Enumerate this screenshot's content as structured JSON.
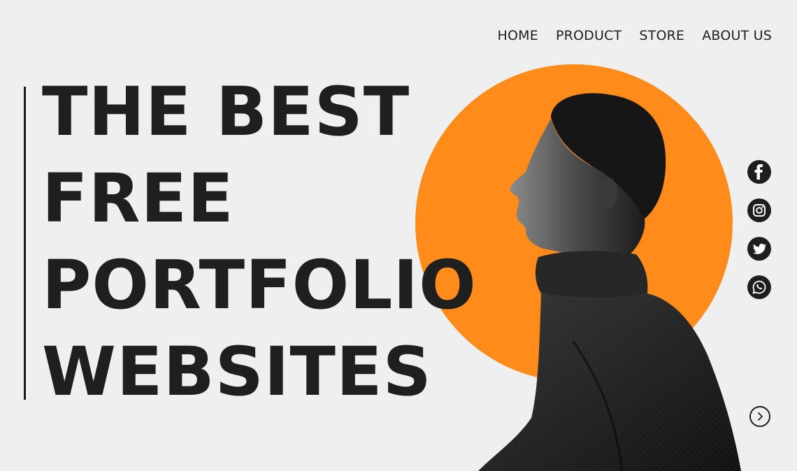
{
  "nav": {
    "items": [
      {
        "label": "HOME"
      },
      {
        "label": "PRODUCT"
      },
      {
        "label": "STORE"
      },
      {
        "label": "ABOUT US"
      }
    ]
  },
  "hero": {
    "lines": [
      "THE BEST",
      "FREE",
      "PORTFOLIO",
      "WEBSITES"
    ],
    "accent_color": "#ff8c1a",
    "image": "portrait-of-man-in-turtleneck-profile"
  },
  "socials": [
    {
      "icon": "facebook-icon"
    },
    {
      "icon": "instagram-icon"
    },
    {
      "icon": "twitter-icon"
    },
    {
      "icon": "whatsapp-icon"
    }
  ],
  "next": {
    "icon": "chevron-right-icon"
  },
  "colors": {
    "background": "#efefef",
    "text": "#1e1e1e",
    "accent": "#ff8c1a"
  }
}
